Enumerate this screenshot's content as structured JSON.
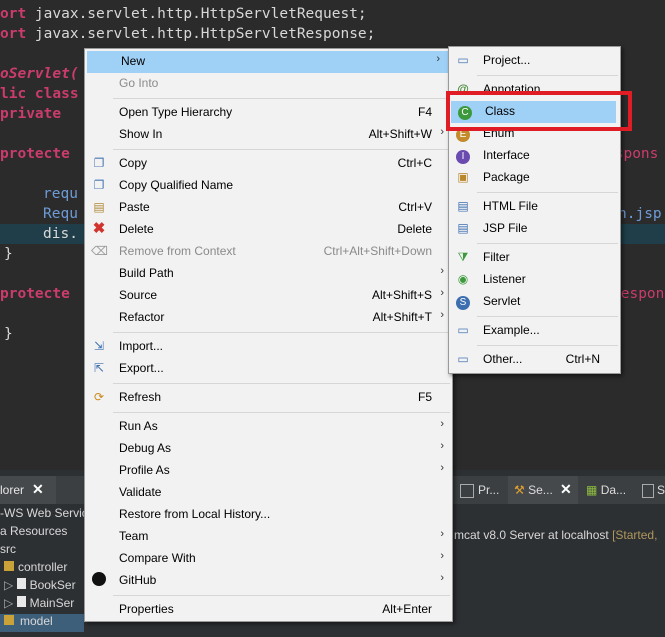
{
  "editor": {
    "lines": [
      {
        "prefix": "ort",
        "rest": " javax.servlet.http.HttpServletRequest;"
      },
      {
        "prefix": "ort",
        "rest": " javax.servlet.http.HttpServletResponse;"
      },
      {
        "prefix": "oServlet(",
        "rest": ""
      },
      {
        "prefix": "lic class",
        "rest": ""
      },
      {
        "prefix": "private",
        "rest": ""
      },
      {
        "prefix": "protecte",
        "rest": ""
      },
      {
        "prefix": "requ",
        "rest": ""
      },
      {
        "prefix": "Requ",
        "rest": ""
      },
      {
        "prefix": "dis.",
        "rest": ""
      },
      {
        "prefix": "}",
        "rest": ""
      },
      {
        "prefix": "protecte",
        "rest": ""
      },
      {
        "prefix": "}",
        "rest": ""
      }
    ],
    "right_fragments": [
      "espons",
      "n.jsp",
      "Respon"
    ]
  },
  "bottom": {
    "explorer_tab": "lorer",
    "tree": [
      "-WS Web Servic",
      "a Resources",
      "src",
      "controller",
      "BookSer",
      "MainSer",
      "model"
    ],
    "right_tabs": [
      "Pr...",
      "Se...",
      "Da...",
      "S"
    ],
    "server_text": "mcat v8.0 Server at localhost",
    "server_status": "[Started,"
  },
  "context_menu": {
    "items": [
      {
        "label": "New",
        "shortcut": "",
        "submenu": true,
        "icon": "new-icon",
        "hover": true
      },
      {
        "label": "Go Into",
        "shortcut": "",
        "disabled": true
      },
      {
        "sep": true
      },
      {
        "label": "Open Type Hierarchy",
        "shortcut": "F4"
      },
      {
        "label": "Show In",
        "shortcut": "Alt+Shift+W",
        "submenu": true
      },
      {
        "sep": true
      },
      {
        "label": "Copy",
        "shortcut": "Ctrl+C",
        "icon": "copy-icon"
      },
      {
        "label": "Copy Qualified Name",
        "shortcut": "",
        "icon": "copy-qualified-icon"
      },
      {
        "label": "Paste",
        "shortcut": "Ctrl+V",
        "icon": "paste-icon"
      },
      {
        "label": "Delete",
        "shortcut": "Delete",
        "icon": "delete-icon"
      },
      {
        "label": "Remove from Context",
        "shortcut": "Ctrl+Alt+Shift+Down",
        "disabled": true,
        "icon": "remove-context-icon"
      },
      {
        "label": "Build Path",
        "shortcut": "",
        "submenu": true
      },
      {
        "label": "Source",
        "shortcut": "Alt+Shift+S",
        "submenu": true
      },
      {
        "label": "Refactor",
        "shortcut": "Alt+Shift+T",
        "submenu": true
      },
      {
        "sep": true
      },
      {
        "label": "Import...",
        "shortcut": "",
        "icon": "import-icon"
      },
      {
        "label": "Export...",
        "shortcut": "",
        "icon": "export-icon"
      },
      {
        "sep": true
      },
      {
        "label": "Refresh",
        "shortcut": "F5",
        "icon": "refresh-icon"
      },
      {
        "sep": true
      },
      {
        "label": "Run As",
        "shortcut": "",
        "submenu": true
      },
      {
        "label": "Debug As",
        "shortcut": "",
        "submenu": true
      },
      {
        "label": "Profile As",
        "shortcut": "",
        "submenu": true
      },
      {
        "label": "Validate",
        "shortcut": ""
      },
      {
        "label": "Restore from Local History...",
        "shortcut": ""
      },
      {
        "label": "Team",
        "shortcut": "",
        "submenu": true
      },
      {
        "label": "Compare With",
        "shortcut": "",
        "submenu": true
      },
      {
        "label": "GitHub",
        "shortcut": "",
        "submenu": true,
        "icon": "github-icon"
      },
      {
        "sep": true
      },
      {
        "label": "Properties",
        "shortcut": "Alt+Enter"
      }
    ]
  },
  "new_submenu": {
    "items": [
      {
        "label": "Project...",
        "icon": "project-icon"
      },
      {
        "sep": true
      },
      {
        "label": "Annotation",
        "icon": "annotation-icon"
      },
      {
        "label": "Class",
        "icon": "class-icon",
        "hover": true
      },
      {
        "label": "Enum",
        "icon": "enum-icon"
      },
      {
        "label": "Interface",
        "icon": "interface-icon"
      },
      {
        "label": "Package",
        "icon": "package-icon"
      },
      {
        "sep": true
      },
      {
        "label": "HTML File",
        "icon": "html-file-icon"
      },
      {
        "label": "JSP File",
        "icon": "jsp-file-icon"
      },
      {
        "sep": true
      },
      {
        "label": "Filter",
        "icon": "filter-icon"
      },
      {
        "label": "Listener",
        "icon": "listener-icon"
      },
      {
        "label": "Servlet",
        "icon": "servlet-icon"
      },
      {
        "sep": true
      },
      {
        "label": "Example...",
        "icon": "example-icon"
      },
      {
        "sep": true
      },
      {
        "label": "Other...",
        "shortcut": "Ctrl+N",
        "icon": "other-icon"
      }
    ]
  }
}
